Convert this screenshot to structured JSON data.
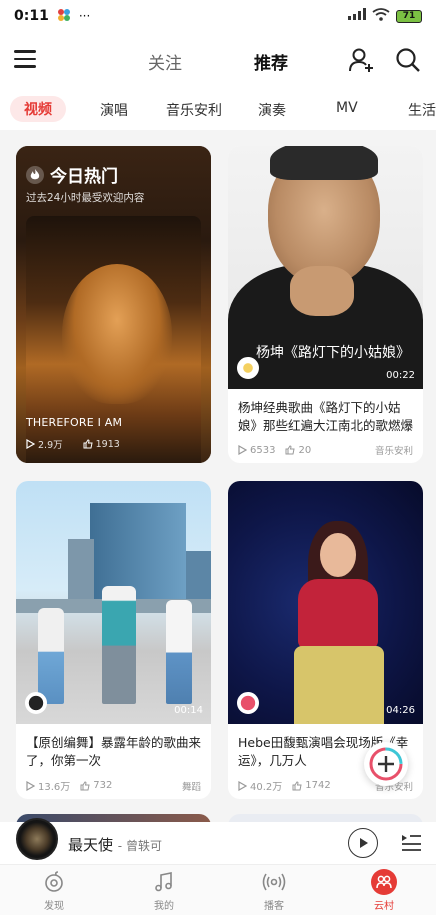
{
  "status_bar": {
    "time": "0:11",
    "battery": "71",
    "notif_icon": "petal-icon",
    "more": "···"
  },
  "header": {
    "tabs": [
      {
        "label": "关注"
      },
      {
        "label": "推荐"
      }
    ],
    "active_tab": "推荐"
  },
  "categories": [
    "视频",
    "演唱",
    "音乐安利",
    "演奏",
    "MV",
    "生活"
  ],
  "active_category": "视频",
  "hot_card": {
    "title": "今日热门",
    "subtitle": "过去24小时最受欢迎内容",
    "caption": "THEREFORE I AM",
    "plays": "2.9万",
    "likes": "1913"
  },
  "cards": [
    {
      "overlay_text": "杨坤《路灯下的小姑娘》",
      "duration": "00:22",
      "title": "杨坤经典歌曲《路灯下的小姑娘》那些红遍大江南北的歌燃爆全场!",
      "plays": "6533",
      "likes": "20",
      "tag": "音乐安利"
    },
    {
      "duration": "00:14",
      "title": "【原创编舞】暴露年龄的歌曲来了，你第一次",
      "plays": "13.6万",
      "likes": "732",
      "tag": "舞蹈"
    },
    {
      "duration": "04:26",
      "title": "Hebe田馥甄演唱会现场版《幸运》，几万人",
      "plays": "40.2万",
      "likes": "1742",
      "tag": "音乐安利"
    }
  ],
  "mini_player": {
    "song": "最天使",
    "artist": "曾轶可"
  },
  "bottom_nav": [
    {
      "label": "发现",
      "icon": "discover-icon"
    },
    {
      "label": "我的",
      "icon": "music-note-icon"
    },
    {
      "label": "播客",
      "icon": "podcast-icon"
    },
    {
      "label": "云村",
      "icon": "cloud-village-icon"
    }
  ],
  "colors": {
    "accent": "#e53b36",
    "background": "#f4f4f4"
  }
}
